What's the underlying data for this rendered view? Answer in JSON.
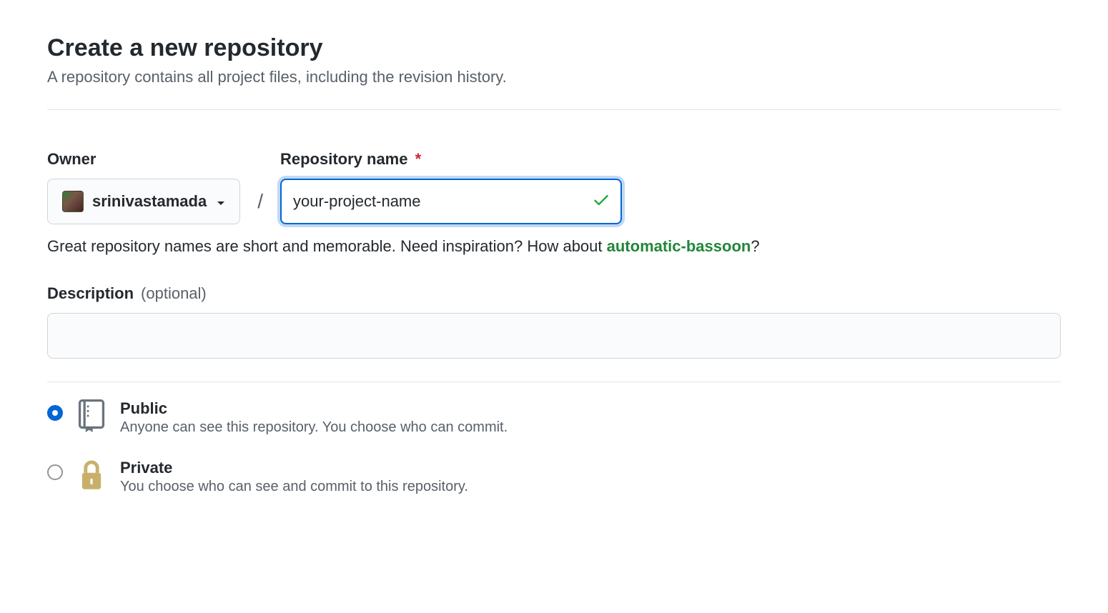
{
  "header": {
    "title": "Create a new repository",
    "subtitle": "A repository contains all project files, including the revision history."
  },
  "owner": {
    "label": "Owner",
    "username": "srinivastamada"
  },
  "repo": {
    "label": "Repository name",
    "required_marker": "*",
    "value": "your-project-name"
  },
  "hint": {
    "prefix": "Great repository names are short and memorable. Need inspiration? How about ",
    "suggestion": "automatic-bassoon",
    "suffix": "?"
  },
  "description": {
    "label": "Description",
    "optional_label": "(optional)",
    "value": ""
  },
  "visibility": {
    "public": {
      "title": "Public",
      "desc": "Anyone can see this repository. You choose who can commit.",
      "selected": true
    },
    "private": {
      "title": "Private",
      "desc": "You choose who can see and commit to this repository.",
      "selected": false
    }
  }
}
